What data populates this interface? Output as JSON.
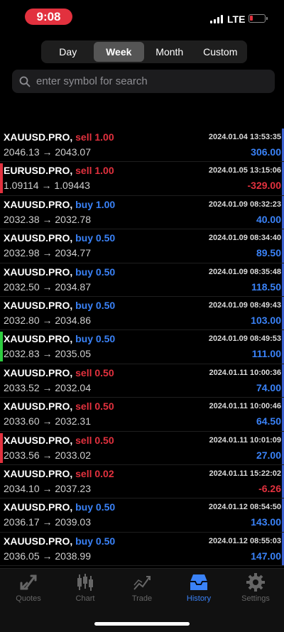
{
  "status": {
    "time": "9:08",
    "network": "LTE"
  },
  "periods": [
    {
      "label": "Day",
      "active": false
    },
    {
      "label": "Week",
      "active": true
    },
    {
      "label": "Month",
      "active": false
    },
    {
      "label": "Custom",
      "active": false
    }
  ],
  "search": {
    "placeholder": "enter symbol for search"
  },
  "trades": [
    {
      "symbol": "XAUUSD.PRO,",
      "side": "sell 1.00",
      "sideType": "sell",
      "from": "2046.13",
      "to": "2043.07",
      "date": "2024.01.04 13:53:35",
      "profit": "306.00",
      "profitType": "pos",
      "accent": ""
    },
    {
      "symbol": "EURUSD.PRO,",
      "side": "sell 1.00",
      "sideType": "sell",
      "from": "1.09114",
      "to": "1.09443",
      "date": "2024.01.05 13:15:06",
      "profit": "-329.00",
      "profitType": "neg",
      "accent": "#e2313e"
    },
    {
      "symbol": "XAUUSD.PRO,",
      "side": "buy 1.00",
      "sideType": "buy",
      "from": "2032.38",
      "to": "2032.78",
      "date": "2024.01.09 08:32:23",
      "profit": "40.00",
      "profitType": "pos",
      "accent": ""
    },
    {
      "symbol": "XAUUSD.PRO,",
      "side": "buy 0.50",
      "sideType": "buy",
      "from": "2032.98",
      "to": "2034.77",
      "date": "2024.01.09 08:34:40",
      "profit": "89.50",
      "profitType": "pos",
      "accent": ""
    },
    {
      "symbol": "XAUUSD.PRO,",
      "side": "buy 0.50",
      "sideType": "buy",
      "from": "2032.50",
      "to": "2034.87",
      "date": "2024.01.09 08:35:48",
      "profit": "118.50",
      "profitType": "pos",
      "accent": ""
    },
    {
      "symbol": "XAUUSD.PRO,",
      "side": "buy 0.50",
      "sideType": "buy",
      "from": "2032.80",
      "to": "2034.86",
      "date": "2024.01.09 08:49:43",
      "profit": "103.00",
      "profitType": "pos",
      "accent": ""
    },
    {
      "symbol": "XAUUSD.PRO,",
      "side": "buy 0.50",
      "sideType": "buy",
      "from": "2032.83",
      "to": "2035.05",
      "date": "2024.01.09 08:49:53",
      "profit": "111.00",
      "profitType": "pos",
      "accent": "#2ecc40"
    },
    {
      "symbol": "XAUUSD.PRO,",
      "side": "sell 0.50",
      "sideType": "sell",
      "from": "2033.52",
      "to": "2032.04",
      "date": "2024.01.11 10:00:36",
      "profit": "74.00",
      "profitType": "pos",
      "accent": ""
    },
    {
      "symbol": "XAUUSD.PRO,",
      "side": "sell 0.50",
      "sideType": "sell",
      "from": "2033.60",
      "to": "2032.31",
      "date": "2024.01.11 10:00:46",
      "profit": "64.50",
      "profitType": "pos",
      "accent": ""
    },
    {
      "symbol": "XAUUSD.PRO,",
      "side": "sell 0.50",
      "sideType": "sell",
      "from": "2033.56",
      "to": "2033.02",
      "date": "2024.01.11 10:01:09",
      "profit": "27.00",
      "profitType": "pos",
      "accent": "#e2313e"
    },
    {
      "symbol": "XAUUSD.PRO,",
      "side": "sell 0.02",
      "sideType": "sell",
      "from": "2034.10",
      "to": "2037.23",
      "date": "2024.01.11 15:22:02",
      "profit": "-6.26",
      "profitType": "neg",
      "accent": ""
    },
    {
      "symbol": "XAUUSD.PRO,",
      "side": "buy 0.50",
      "sideType": "buy",
      "from": "2036.17",
      "to": "2039.03",
      "date": "2024.01.12 08:54:50",
      "profit": "143.00",
      "profitType": "pos",
      "accent": ""
    },
    {
      "symbol": "XAUUSD.PRO,",
      "side": "buy 0.50",
      "sideType": "buy",
      "from": "2036.05",
      "to": "2038.99",
      "date": "2024.01.12 08:55:03",
      "profit": "147.00",
      "profitType": "pos",
      "accent": ""
    }
  ],
  "arrow": "→",
  "tabs": [
    {
      "label": "Quotes",
      "icon": "quotes-icon",
      "active": false
    },
    {
      "label": "Chart",
      "icon": "chart-icon",
      "active": false
    },
    {
      "label": "Trade",
      "icon": "trade-icon",
      "active": false
    },
    {
      "label": "History",
      "icon": "history-icon",
      "active": true
    },
    {
      "label": "Settings",
      "icon": "settings-icon",
      "active": false
    }
  ],
  "colors": {
    "accent": "#3a82f7",
    "sell": "#e2313e",
    "buy": "#3a82f7",
    "statusPill": "#e2313e"
  }
}
